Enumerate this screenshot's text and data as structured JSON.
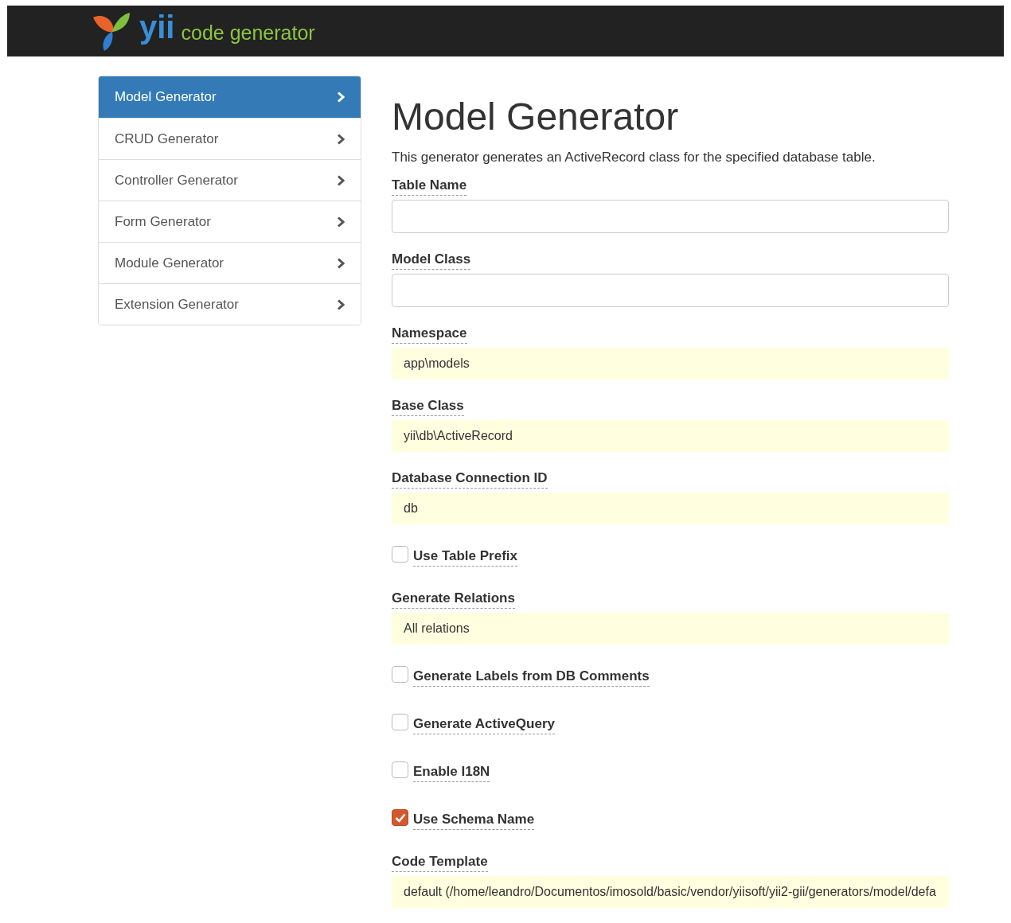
{
  "header": {
    "logo_text": "yii",
    "subtitle": "code generator"
  },
  "sidebar": {
    "items": [
      {
        "label": "Model Generator",
        "selected": true
      },
      {
        "label": "CRUD Generator",
        "selected": false
      },
      {
        "label": "Controller Generator",
        "selected": false
      },
      {
        "label": "Form Generator",
        "selected": false
      },
      {
        "label": "Module Generator",
        "selected": false
      },
      {
        "label": "Extension Generator",
        "selected": false
      }
    ]
  },
  "main": {
    "title": "Model Generator",
    "description": "This generator generates an ActiveRecord class for the specified database table.",
    "fields": [
      {
        "kind": "input",
        "label": "Table Name"
      },
      {
        "kind": "input",
        "label": "Model Class"
      },
      {
        "kind": "sticky",
        "label": "Namespace",
        "value": "app\\models"
      },
      {
        "kind": "sticky",
        "label": "Base Class",
        "value": "yii\\db\\ActiveRecord"
      },
      {
        "kind": "sticky",
        "label": "Database Connection ID",
        "value": "db"
      },
      {
        "kind": "checkbox",
        "label": "Use Table Prefix",
        "checked": false
      },
      {
        "kind": "sticky",
        "label": "Generate Relations",
        "value": "All relations"
      },
      {
        "kind": "checkbox",
        "label": "Generate Labels from DB Comments",
        "checked": false
      },
      {
        "kind": "checkbox",
        "label": "Generate ActiveQuery",
        "checked": false
      },
      {
        "kind": "checkbox",
        "label": "Enable I18N",
        "checked": false
      },
      {
        "kind": "checkbox",
        "label": "Use Schema Name",
        "checked": true
      },
      {
        "kind": "sticky",
        "label": "Code Template",
        "value": "default (/home/leandro/Documentos/imosold/basic/vendor/yiisoft/yii2-gii/generators/model/defa"
      }
    ]
  }
}
